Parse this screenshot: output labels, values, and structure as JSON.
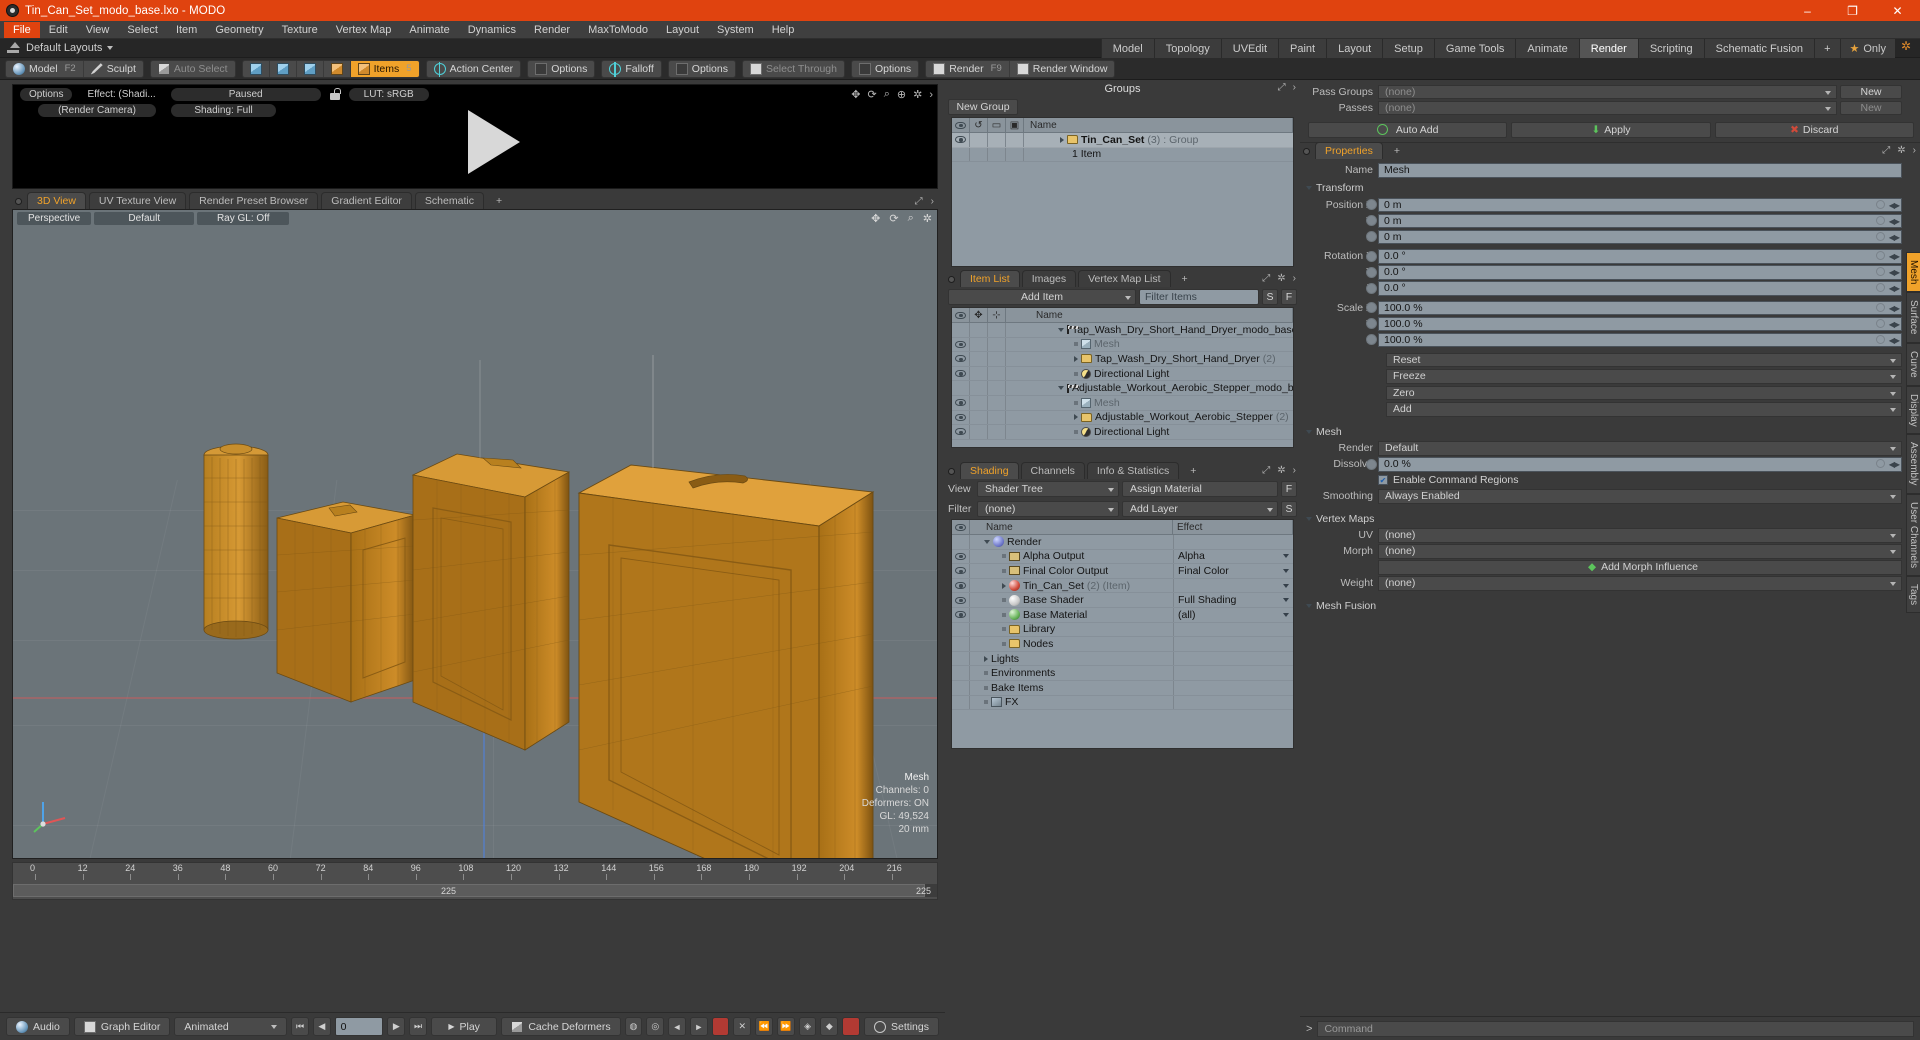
{
  "titlebar": {
    "text": "Tin_Can_Set_modo_base.lxo - MODO",
    "minimize": "–",
    "maximize": "❐",
    "close": "✕"
  },
  "menubar": {
    "items": [
      "File",
      "Edit",
      "View",
      "Select",
      "Item",
      "Geometry",
      "Texture",
      "Vertex Map",
      "Animate",
      "Dynamics",
      "Render",
      "MaxToModo",
      "Layout",
      "System",
      "Help"
    ],
    "active": "File"
  },
  "layoutrow": {
    "label": "Default Layouts",
    "tabs": [
      "Model",
      "Topology",
      "UVEdit",
      "Paint",
      "Layout",
      "Setup",
      "Game Tools",
      "Animate",
      "Render",
      "Scripting",
      "Schematic Fusion",
      "+"
    ],
    "selected": "Render",
    "only_label": "Only"
  },
  "toolbar": {
    "groups": [
      {
        "items": [
          {
            "label": "Model",
            "key": "F2",
            "icon": "sphere-icon",
            "state": "normal"
          },
          {
            "label": "Sculpt",
            "key": "",
            "icon": "pen-icon",
            "state": "normal"
          }
        ]
      },
      {
        "items": [
          {
            "label": "Auto Select",
            "key": "",
            "icon": "cube-grey-icon",
            "state": "dim"
          }
        ]
      },
      {
        "items": [
          {
            "label": "",
            "key": "",
            "icon": "vertex-mode-icon",
            "state": "normal"
          },
          {
            "label": "",
            "key": "",
            "icon": "edge-mode-icon",
            "state": "normal"
          },
          {
            "label": "",
            "key": "",
            "icon": "polygon-mode-icon",
            "state": "normal"
          },
          {
            "label": "",
            "key": "",
            "icon": "material-mode-icon",
            "state": "normal"
          },
          {
            "label": "Items",
            "key": "5",
            "icon": "items-mode-icon",
            "state": "on"
          }
        ]
      },
      {
        "items": [
          {
            "label": "Action Center",
            "key": "",
            "icon": "action-center-icon",
            "state": "normal"
          }
        ]
      },
      {
        "items": [
          {
            "label": "Options",
            "key": "",
            "icon": "options-icon",
            "state": "normal"
          }
        ]
      },
      {
        "items": [
          {
            "label": "Falloff",
            "key": "",
            "icon": "falloff-icon",
            "state": "normal"
          }
        ]
      },
      {
        "items": [
          {
            "label": "Options",
            "key": "",
            "icon": "options-icon",
            "state": "normal"
          }
        ]
      },
      {
        "items": [
          {
            "label": "Select Through",
            "key": "",
            "icon": "select-through-icon",
            "state": "dim"
          }
        ]
      },
      {
        "items": [
          {
            "label": "Options",
            "key": "",
            "icon": "options-icon",
            "state": "normal"
          }
        ]
      },
      {
        "items": [
          {
            "label": "Render",
            "key": "F9",
            "icon": "render-icon",
            "state": "normal"
          },
          {
            "label": "Render Window",
            "key": "",
            "icon": "render-window-icon",
            "state": "normal"
          }
        ]
      }
    ]
  },
  "preview": {
    "row1": [
      "Options",
      "Effect: (Shadi...",
      "Paused"
    ],
    "lock_icon": "unlock-icon",
    "lut": "LUT: sRGB",
    "row2": [
      "(Render Camera)",
      "Shading: Full"
    ],
    "icons": [
      "move-icon",
      "rotate-icon",
      "zoom-icon",
      "fit-icon",
      "gear-icon",
      "chevron-right-icon"
    ]
  },
  "viewport_tabs": {
    "tabs": [
      "3D View",
      "UV Texture View",
      "Render Preset Browser",
      "Gradient Editor",
      "Schematic",
      "+"
    ],
    "selected": "3D View"
  },
  "viewport": {
    "pills": [
      "Perspective",
      "Default",
      "Ray GL: Off"
    ],
    "icons": [
      "move-icon",
      "rotate-icon",
      "zoom-icon",
      "gear-icon"
    ],
    "stats": {
      "title": "Mesh",
      "channels": "Channels: 0",
      "deformers": "Deformers: ON",
      "gl": "GL: 49,524",
      "scale": "20 mm"
    }
  },
  "timeline": {
    "ticks": [
      "0",
      "12",
      "24",
      "36",
      "48",
      "60",
      "72",
      "84",
      "96",
      "108",
      "120",
      "132",
      "144",
      "156",
      "168",
      "180",
      "192",
      "204",
      "216"
    ],
    "range_end": "225",
    "range_label_left": "225"
  },
  "bottombar": {
    "audio": "Audio",
    "graph_editor": "Graph Editor",
    "animated": "Animated",
    "frame_value": "0",
    "play": "Play",
    "cache": "Cache Deformers",
    "settings": "Settings"
  },
  "groups_panel": {
    "title": "Groups",
    "new_group_button": "New Group",
    "columns": [
      "",
      "",
      "",
      "",
      "Name"
    ],
    "rows": [
      {
        "name": "Tin_Can_Set",
        "count": "(3)",
        "suffix": ": Group",
        "icon": "group-icon",
        "selected": true
      },
      {
        "name": "1 Item",
        "count": "",
        "suffix": "",
        "icon": "",
        "selected": false
      }
    ]
  },
  "itemlist_panel": {
    "tabs": [
      "Item List",
      "Images",
      "Vertex Map List",
      "+"
    ],
    "selected_tab": "Item List",
    "add_item": "Add Item",
    "filter_placeholder": "Filter Items",
    "filter_buttons": [
      "S",
      "F"
    ],
    "columns": [
      "eye",
      "move",
      "axis",
      "Name"
    ],
    "rows": [
      {
        "indent": 0,
        "twirl": "down",
        "icon": "scene-icon",
        "label": "Tap_Wash_Dry_Short_Hand_Dryer_modo_base.lxo",
        "count": "",
        "eye": false,
        "dim": false
      },
      {
        "indent": 1,
        "twirl": "none",
        "icon": "mesh-icon",
        "label": "Mesh",
        "count": "",
        "eye": true,
        "dim": true
      },
      {
        "indent": 1,
        "twirl": "right",
        "icon": "folder-icon",
        "label": "Tap_Wash_Dry_Short_Hand_Dryer",
        "count": "(2)",
        "eye": true,
        "dim": false
      },
      {
        "indent": 1,
        "twirl": "none",
        "icon": "light-icon",
        "label": "Directional Light",
        "count": "",
        "eye": true,
        "dim": false
      },
      {
        "indent": 0,
        "twirl": "down",
        "icon": "scene-icon",
        "label": "Adjustable_Workout_Aerobic_Stepper_modo_base.lxo",
        "count": "",
        "eye": false,
        "dim": false
      },
      {
        "indent": 1,
        "twirl": "none",
        "icon": "mesh-icon",
        "label": "Mesh",
        "count": "",
        "eye": true,
        "dim": true
      },
      {
        "indent": 1,
        "twirl": "right",
        "icon": "folder-icon",
        "label": "Adjustable_Workout_Aerobic_Stepper",
        "count": "(2)",
        "eye": true,
        "dim": false
      },
      {
        "indent": 1,
        "twirl": "none",
        "icon": "light-icon",
        "label": "Directional Light",
        "count": "",
        "eye": true,
        "dim": false
      }
    ]
  },
  "shading_panel": {
    "tabs": [
      "Shading",
      "Channels",
      "Info & Statistics",
      "+"
    ],
    "selected_tab": "Shading",
    "view_label": "View",
    "view_value": "Shader Tree",
    "assign_material": "Assign Material",
    "assign_btn": "F",
    "filter_label": "Filter",
    "filter_value": "(none)",
    "add_layer": "Add Layer",
    "add_layer_btn": "S",
    "columns": [
      "eye",
      "Name",
      "Effect"
    ],
    "rows": [
      {
        "indent": 0,
        "twirl": "down",
        "icon": "render-icon",
        "label": "Render",
        "count": "",
        "effect": "",
        "eye": false
      },
      {
        "indent": 1,
        "twirl": "none",
        "icon": "image-icon",
        "label": "Alpha Output",
        "count": "",
        "effect": "Alpha",
        "eye": true
      },
      {
        "indent": 1,
        "twirl": "none",
        "icon": "image-icon",
        "label": "Final Color Output",
        "count": "",
        "effect": "Final Color",
        "eye": true
      },
      {
        "indent": 1,
        "twirl": "right",
        "icon": "material-red-icon",
        "label": "Tin_Can_Set",
        "count": "(2) (Item)",
        "effect": "",
        "eye": true
      },
      {
        "indent": 1,
        "twirl": "none",
        "icon": "shader-icon",
        "label": "Base Shader",
        "count": "",
        "effect": "Full Shading",
        "eye": true
      },
      {
        "indent": 1,
        "twirl": "none",
        "icon": "material-green-icon",
        "label": "Base Material",
        "count": "",
        "effect": "(all)",
        "eye": true
      },
      {
        "indent": 1,
        "twirl": "none",
        "icon": "folder-icon",
        "label": "Library",
        "count": "",
        "effect": "",
        "eye": false
      },
      {
        "indent": 1,
        "twirl": "none",
        "icon": "folder-icon",
        "label": "Nodes",
        "count": "",
        "effect": "",
        "eye": false
      },
      {
        "indent": 0,
        "twirl": "right",
        "icon": "",
        "label": "Lights",
        "count": "",
        "effect": "",
        "eye": false
      },
      {
        "indent": 0,
        "twirl": "none",
        "icon": "",
        "label": "Environments",
        "count": "",
        "effect": "",
        "eye": false
      },
      {
        "indent": 0,
        "twirl": "none",
        "icon": "",
        "label": "Bake Items",
        "count": "",
        "effect": "",
        "eye": false
      },
      {
        "indent": 0,
        "twirl": "none",
        "icon": "fx-icon",
        "label": "FX",
        "count": "",
        "effect": "",
        "eye": false
      }
    ]
  },
  "passes_panel": {
    "pass_groups_label": "Pass Groups",
    "pass_groups_value": "(none)",
    "pass_groups_new": "New",
    "passes_label": "Passes",
    "passes_value": "(none)",
    "passes_new": "New",
    "auto_add": "Auto Add",
    "apply": "Apply",
    "discard": "Discard"
  },
  "properties_panel": {
    "tabs": [
      "Properties",
      "+"
    ],
    "selected_tab": "Properties",
    "name_label": "Name",
    "name_value": "Mesh",
    "transform_header": "Transform",
    "transform_rows": [
      {
        "label": "Position X",
        "value": "0 m"
      },
      {
        "label": "Y",
        "value": "0 m"
      },
      {
        "label": "Z",
        "value": "0 m"
      },
      {
        "label": "Rotation X",
        "value": "0.0 °"
      },
      {
        "label": "Y",
        "value": "0.0 °"
      },
      {
        "label": "Z",
        "value": "0.0 °"
      },
      {
        "label": "Scale X",
        "value": "100.0 %"
      },
      {
        "label": "Y",
        "value": "100.0 %"
      },
      {
        "label": "Z",
        "value": "100.0 %"
      }
    ],
    "transform_buttons": [
      "Reset",
      "Freeze",
      "Zero",
      "Add"
    ],
    "mesh_header": "Mesh",
    "mesh_rows": [
      {
        "label": "Render",
        "value": "Default",
        "type": "dropdown"
      },
      {
        "label": "Dissolve",
        "value": "0.0 %",
        "type": "field"
      }
    ],
    "enable_cmd_regions": "Enable Command Regions",
    "smoothing_label": "Smoothing",
    "smoothing_value": "Always Enabled",
    "vertexmaps_header": "Vertex Maps",
    "vertexmap_rows": [
      {
        "label": "UV",
        "value": "(none)"
      },
      {
        "label": "Morph",
        "value": "(none)"
      }
    ],
    "add_morph": "Add Morph Influence",
    "weight_label": "Weight",
    "weight_value": "(none)",
    "meshfusion_header": "Mesh Fusion",
    "side_tabs": [
      "Mesh",
      "Surface",
      "Curve",
      "Display",
      "Assembly",
      "User Channels",
      "Tags"
    ],
    "side_selected": "Mesh"
  },
  "commandbar": {
    "placeholder": "Command",
    "prompt": ">"
  },
  "colors": {
    "accent": "#e0430f",
    "highlight": "#f0a22a",
    "panel": "#3a3a3a",
    "field": "#8f9aa3",
    "viewport": "#6b7479",
    "model": "#c07f22"
  }
}
